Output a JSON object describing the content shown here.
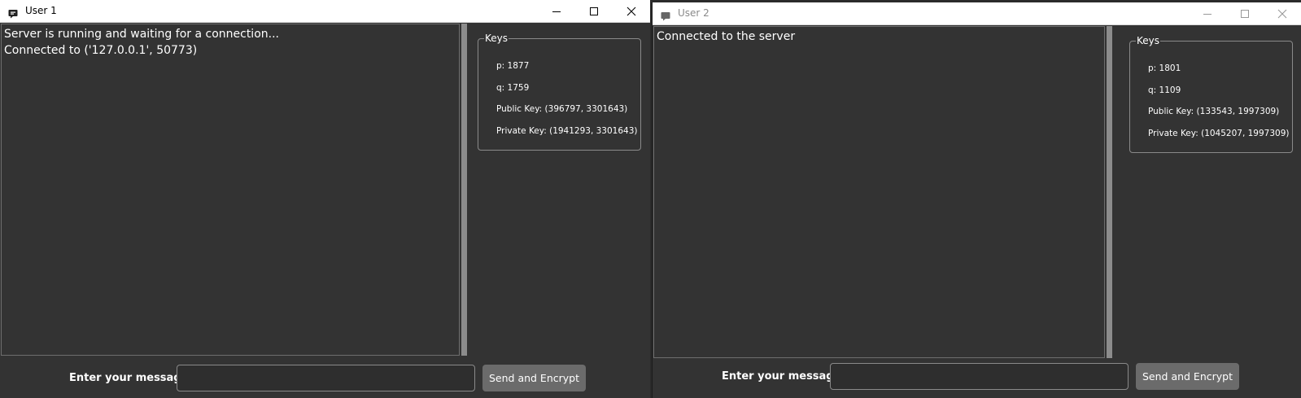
{
  "windows": [
    {
      "title": "User 1",
      "chat_lines": [
        "Server is running and waiting for a connection...",
        "Connected to ('127.0.0.1', 50773)"
      ],
      "keys": {
        "legend": "Keys",
        "p": "p: 1877",
        "q": "q: 1759",
        "public_key": "Public Key: (396797, 3301643)",
        "private_key": "Private Key: (1941293, 3301643)"
      },
      "message_label": "Enter your message:",
      "message_value": "",
      "send_label": "Send and Encrypt"
    },
    {
      "title": "User 2",
      "chat_lines": [
        "Connected to the server"
      ],
      "keys": {
        "legend": "Keys",
        "p": "p: 1801",
        "q": "q: 1109",
        "public_key": "Public Key: (133543, 1997309)",
        "private_key": "Private Key: (1045207, 1997309)"
      },
      "message_label": "Enter your message:",
      "message_value": "",
      "send_label": "Send and Encrypt"
    }
  ],
  "icons": {
    "app": "chat-bubble-icon",
    "minimize": "minimize-icon",
    "maximize": "maximize-icon",
    "close": "close-icon"
  },
  "colors": {
    "background": "#333333",
    "titlebar": "#ffffff",
    "button": "#6b6b6b",
    "scrollbar": "#8c8c8c",
    "text": "#ffffff"
  }
}
